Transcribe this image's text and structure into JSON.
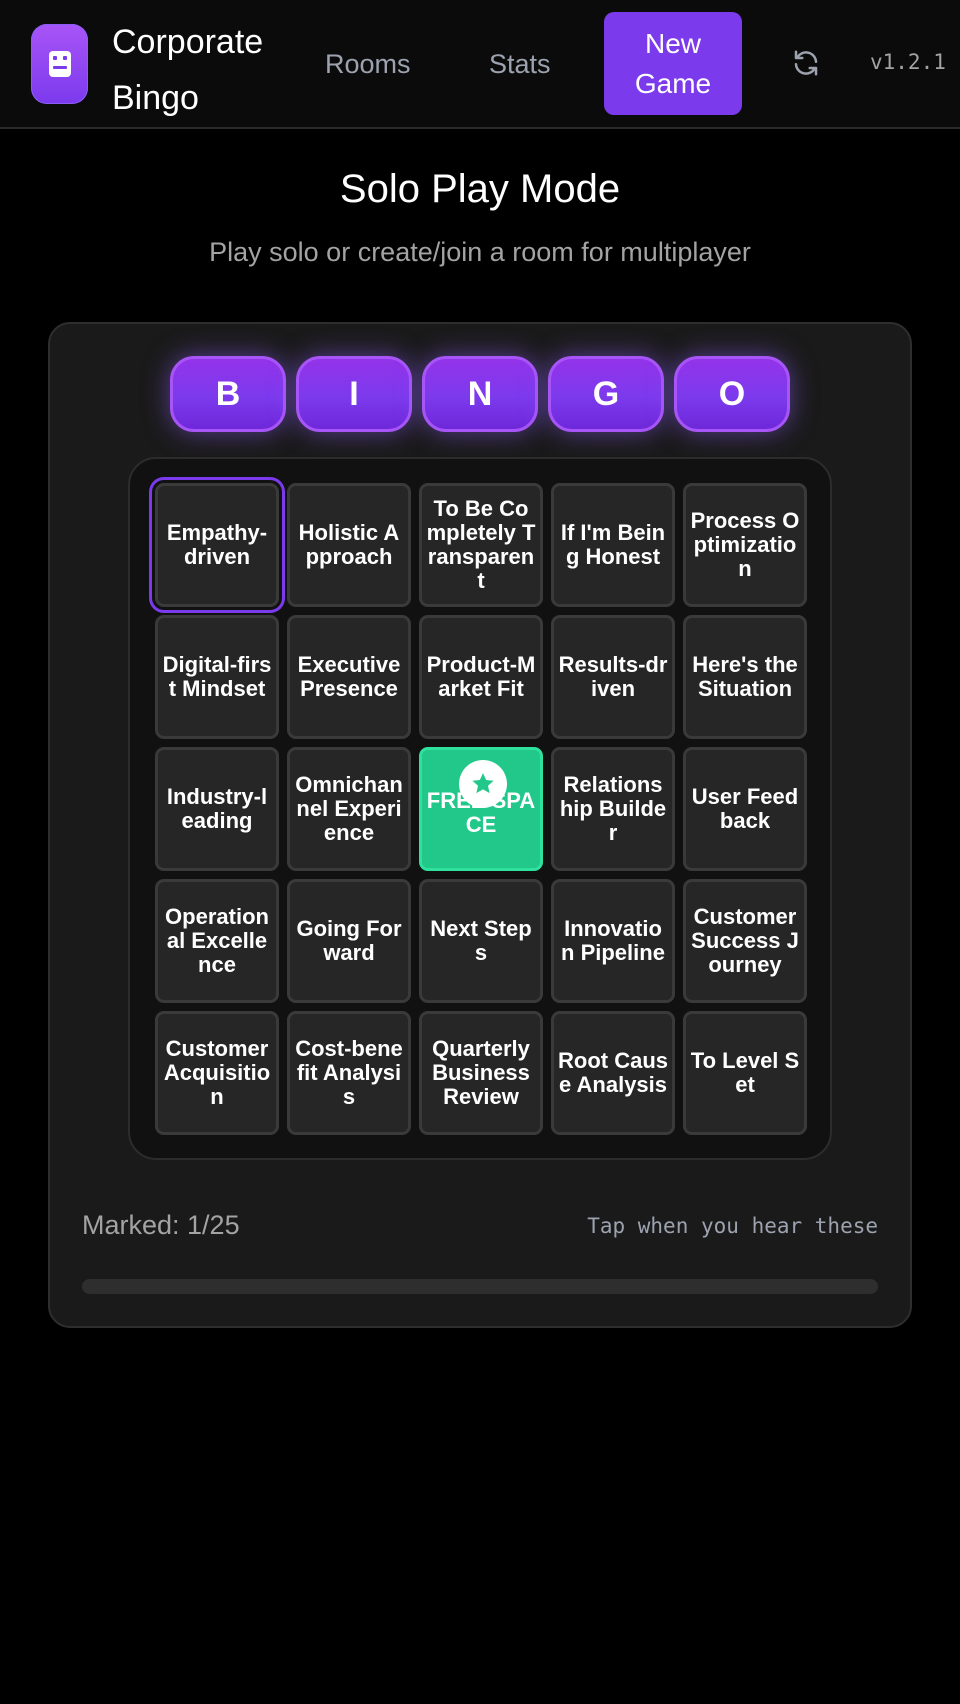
{
  "header": {
    "brand": "Corporate Bingo",
    "nav": [
      "Rooms",
      "Stats"
    ],
    "new_game": "New Game",
    "version": "v1.2.1"
  },
  "page": {
    "title": "Solo Play Mode",
    "subtitle": "Play solo or create/join a room for multiplayer"
  },
  "bingo_letters": [
    "B",
    "I",
    "N",
    "G",
    "O"
  ],
  "board": {
    "cells": [
      "Empathy-driven",
      "Holistic Approach",
      "To Be Completely Transparent",
      "If I'm Being Honest",
      "Process Optimization",
      "Digital-first Mindset",
      "Executive Presence",
      "Product-Market Fit",
      "Results-driven",
      "Here's the Situation",
      "Industry-leading",
      "Omnichannel Experience",
      "FREE SPACE",
      "Relationship Builder",
      "User Feedback",
      "Operational Excellence",
      "Going Forward",
      "Next Steps",
      "Innovation Pipeline",
      "Customer Success Journey",
      "Customer Acquisition",
      "Cost-benefit Analysis",
      "Quarterly Business Review",
      "Root Cause Analysis",
      "To Level Set"
    ],
    "marked_index": 0,
    "free_index": 12
  },
  "footer": {
    "marked_label": "Marked: 1/25",
    "hint": "Tap when you hear these",
    "progress_fraction": 0.0
  },
  "colors": {
    "accent": "#7c3aed",
    "free_space": "#22c78a",
    "background": "#000000"
  },
  "icons": {
    "logo": "robot-icon",
    "refresh": "refresh-icon",
    "free": "star-icon"
  }
}
